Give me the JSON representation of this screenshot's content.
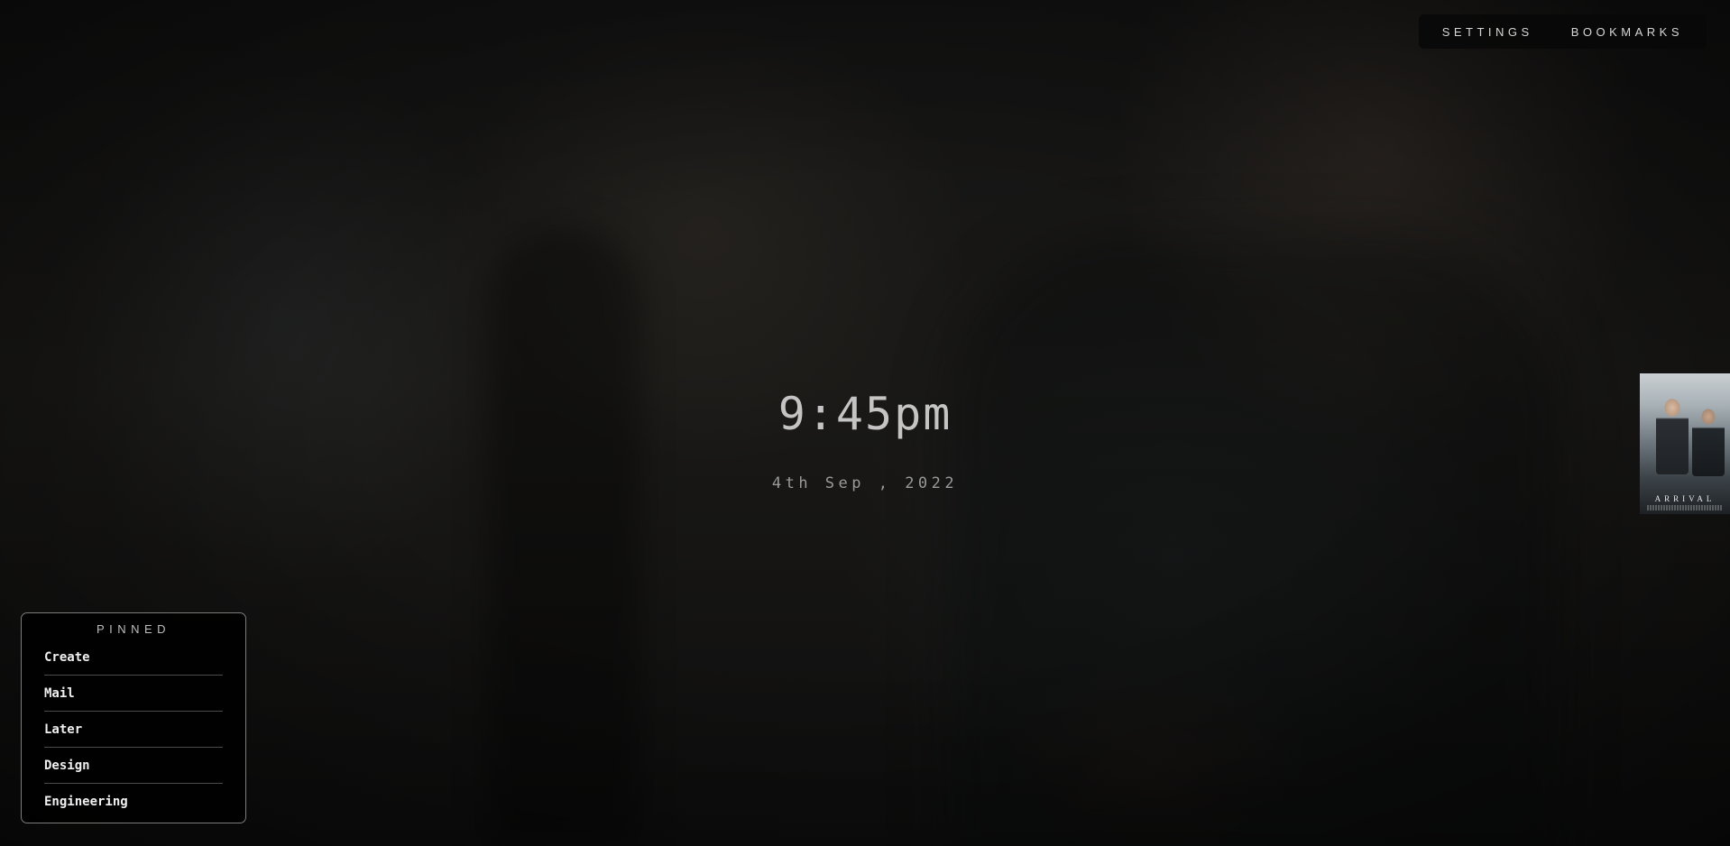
{
  "nav": {
    "settings_label": "SETTINGS",
    "bookmarks_label": "BOOKMARKS"
  },
  "clock": {
    "time": "9:45pm",
    "date": "4th Sep , 2022"
  },
  "poster": {
    "title": "ARRIVAL"
  },
  "pinned": {
    "title": "PINNED",
    "items": [
      {
        "label": "Create"
      },
      {
        "label": "Mail"
      },
      {
        "label": "Later"
      },
      {
        "label": "Design"
      },
      {
        "label": "Engineering"
      }
    ]
  }
}
